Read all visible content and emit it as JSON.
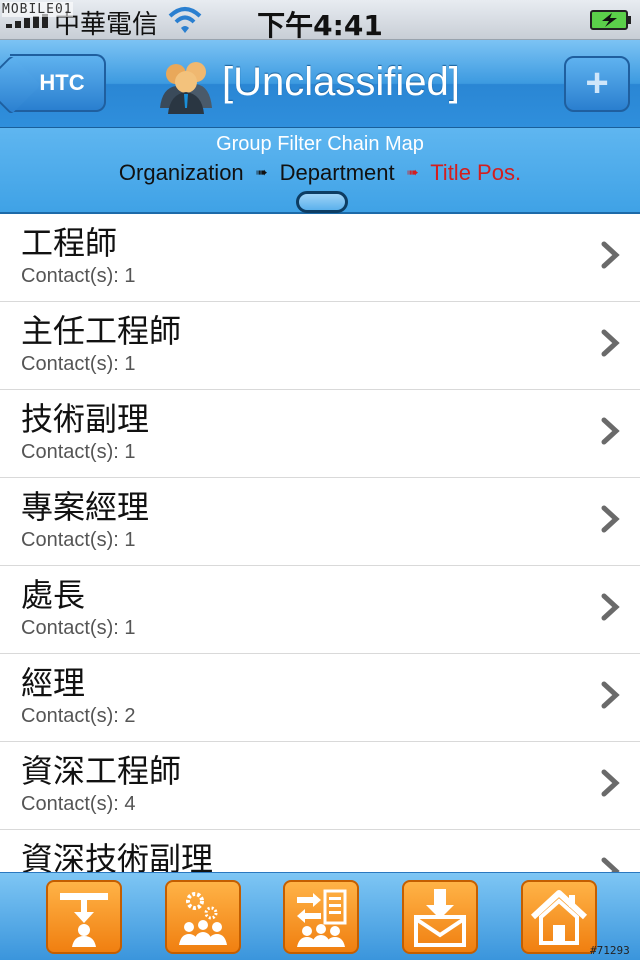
{
  "status_bar": {
    "logo_text": "MOBILE01",
    "carrier": "中華電信",
    "time": "下午4:41",
    "icons": [
      "signal-icon",
      "wifi-icon",
      "battery-charging-icon"
    ]
  },
  "nav": {
    "back_label": "HTC",
    "title": "[Unclassified]",
    "title_icon": "group-people-icon",
    "add_label": "+"
  },
  "filter": {
    "title": "Group Filter Chain Map",
    "chain": [
      "Organization",
      "Department",
      "Title Pos."
    ],
    "active_index": 2
  },
  "list": {
    "items": [
      {
        "title": "工程師",
        "subtitle": "Contact(s): 1"
      },
      {
        "title": "主任工程師",
        "subtitle": "Contact(s): 1"
      },
      {
        "title": "技術副理",
        "subtitle": "Contact(s): 1"
      },
      {
        "title": "專案經理",
        "subtitle": "Contact(s): 1"
      },
      {
        "title": "處長",
        "subtitle": "Contact(s): 1"
      },
      {
        "title": "經理",
        "subtitle": "Contact(s): 2"
      },
      {
        "title": "資深工程師",
        "subtitle": "Contact(s): 4"
      },
      {
        "title": "資深技術副理",
        "subtitle": ""
      }
    ]
  },
  "tabs": [
    {
      "icon": "org-hierarchy-icon"
    },
    {
      "icon": "group-settings-icon"
    },
    {
      "icon": "transfer-list-icon"
    },
    {
      "icon": "download-mail-icon"
    },
    {
      "icon": "home-icon"
    }
  ],
  "watermark": "#71293",
  "colors": {
    "nav_blue": "#2f8fdc",
    "filter_blue": "#4aa9ea",
    "active_red": "#d41e1e",
    "tab_orange": "#f07f10"
  }
}
